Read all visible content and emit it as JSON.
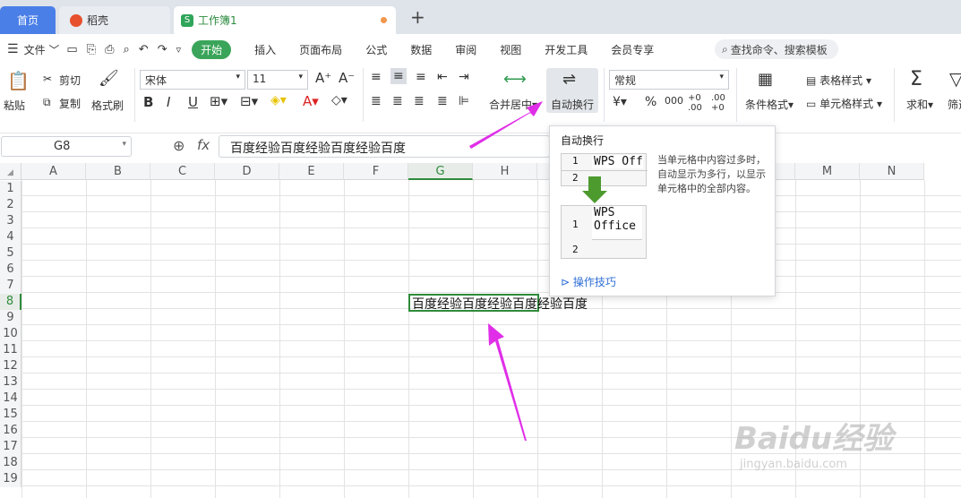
{
  "tabs": {
    "home": "首页",
    "daoke": "稻壳",
    "workbook": "工作簿1",
    "add": "+"
  },
  "menubar": {
    "file": "文件",
    "items": [
      "开始",
      "插入",
      "页面布局",
      "公式",
      "数据",
      "审阅",
      "视图",
      "开发工具",
      "会员专享"
    ],
    "search_placeholder": "查找命令、搜索模板"
  },
  "ribbon": {
    "paste": "粘贴",
    "cut": "剪切",
    "copy": "复制",
    "format_painter": "格式刷",
    "font_name": "宋体",
    "font_size": "11",
    "merge_center": "合并居中",
    "wrap_text": "自动换行",
    "number_format": "常规",
    "conditional_format": "条件格式",
    "table_style": "表格样式",
    "cell_style": "单元格样式",
    "sum": "求和",
    "filter": "筛选"
  },
  "formula_bar": {
    "name_box": "G8",
    "fx": "fx",
    "content": "百度经验百度经验百度经验百度"
  },
  "grid": {
    "columns": [
      "A",
      "B",
      "C",
      "D",
      "E",
      "F",
      "G",
      "H",
      "I",
      "J",
      "K",
      "L",
      "M",
      "N"
    ],
    "rows": [
      "1",
      "2",
      "3",
      "4",
      "5",
      "6",
      "7",
      "8",
      "9",
      "10",
      "11",
      "12",
      "13",
      "14",
      "15",
      "16",
      "17",
      "18",
      "19"
    ],
    "active_cell_text": "百度经验百度经验百度经验百度"
  },
  "tooltip": {
    "title": "自动换行",
    "demo_before_row1": "1",
    "demo_before_text": "WPS Off",
    "demo_before_row2": "2",
    "demo_after_row1": "1",
    "demo_after_line1": "WPS",
    "demo_after_line2": "Office",
    "demo_after_row2": "2",
    "description": "当单元格中内容过多时，自动显示为多行，以显示单元格中的全部内容。",
    "link": "操作技巧"
  },
  "watermark": {
    "brand": "Baidu经验",
    "url": "jingyan.baidu.com"
  },
  "colors": {
    "accent_green": "#3aa55a",
    "tab_blue": "#4a7fe8",
    "annotation_magenta": "#e02ee8"
  }
}
